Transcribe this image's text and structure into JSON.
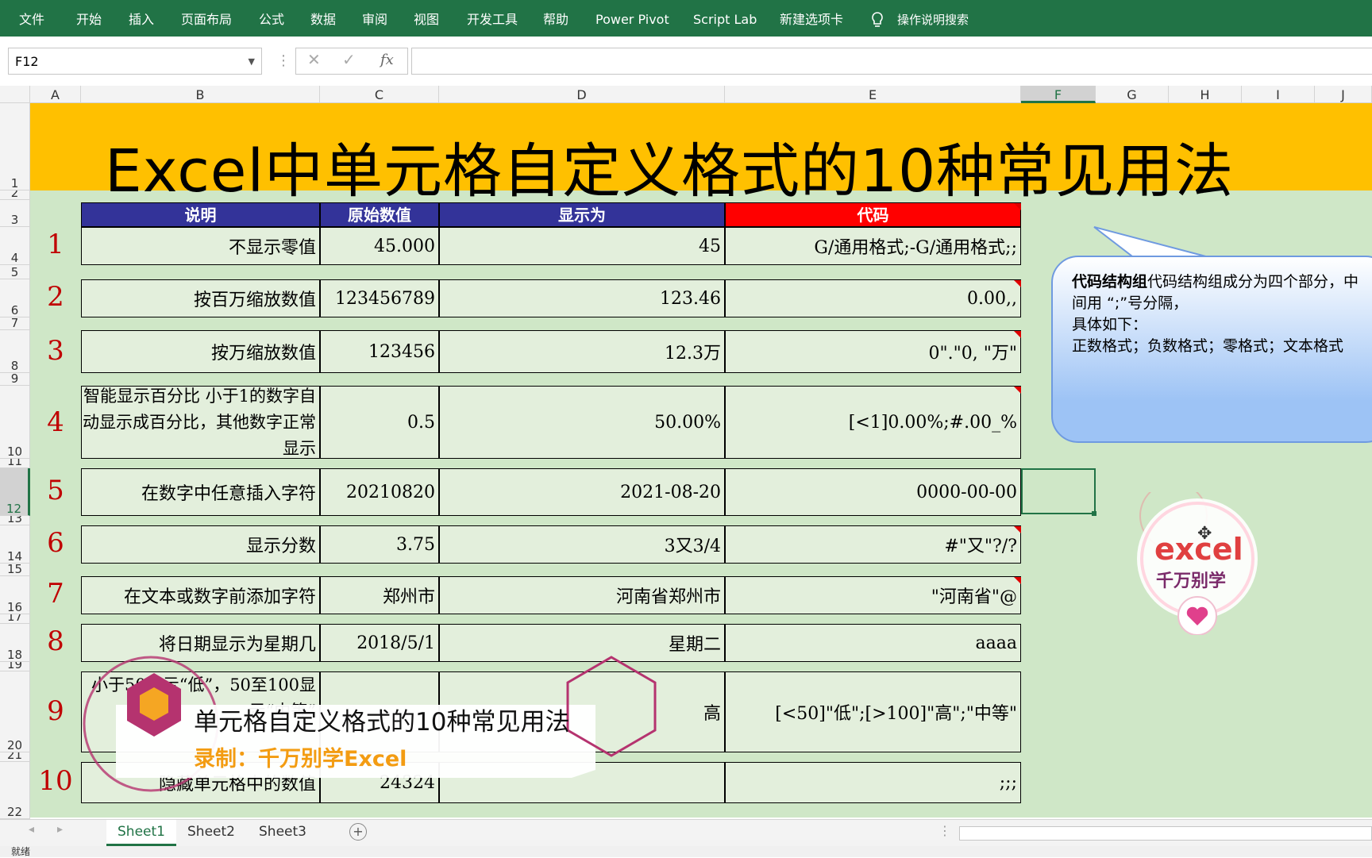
{
  "ribbon": {
    "tabs": [
      "文件",
      "开始",
      "插入",
      "页面布局",
      "公式",
      "数据",
      "审阅",
      "视图",
      "开发工具",
      "帮助",
      "Power Pivot",
      "Script Lab",
      "新建选项卡"
    ],
    "tell_me": "操作说明搜索",
    "color": "#217346"
  },
  "formula_bar": {
    "name_box": "F12",
    "fx": "fx",
    "content": ""
  },
  "columns": [
    "A",
    "B",
    "C",
    "D",
    "E",
    "F",
    "G",
    "H",
    "I",
    "J"
  ],
  "selected_column": "F",
  "rows": [
    "1",
    "2",
    "3",
    "4",
    "5",
    "6",
    "7",
    "8",
    "9",
    "10",
    "11",
    "12",
    "13",
    "14",
    "15",
    "16",
    "17",
    "18",
    "19",
    "20",
    "21",
    "22"
  ],
  "selected_row": "12",
  "title": "Excel中单元格自定义格式的10种常见用法",
  "table": {
    "headers": [
      "说明",
      "原始数值",
      "显示为",
      "代码"
    ],
    "header_color": "#333399",
    "code_header_color": "#ff0000",
    "rows": [
      {
        "n": "1",
        "desc": "不显示零值",
        "raw": "45.000",
        "shown": "45",
        "code": "G/通用格式;-G/通用格式;;"
      },
      {
        "n": "2",
        "desc": "按百万缩放数值",
        "raw": "123456789",
        "shown": "123.46",
        "code": "0.00,,"
      },
      {
        "n": "3",
        "desc": "按万缩放数值",
        "raw": "123456",
        "shown": "12.3万",
        "code": "0\".\"0, \"万\""
      },
      {
        "n": "4",
        "desc": "智能显示百分比 小于1的数字自动显示成百分比，其他数字正常显示",
        "raw": "0.5",
        "shown": "50.00%",
        "code": "[<1]0.00%;#.00_%"
      },
      {
        "n": "5",
        "desc": "在数字中任意插入字符",
        "raw": "20210820",
        "shown": "2021-08-20",
        "code": "0000-00-00"
      },
      {
        "n": "6",
        "desc": "显示分数",
        "raw": "3.75",
        "shown": "3又3/4",
        "code": "#\"又\"?/?"
      },
      {
        "n": "7",
        "desc": "在文本或数字前添加字符",
        "raw": "郑州市",
        "shown": "河南省郑州市",
        "code": "\"河南省\"@"
      },
      {
        "n": "8",
        "desc": "将日期显示为星期几",
        "raw": "2018/5/1",
        "shown": "星期二",
        "code": "aaaa"
      },
      {
        "n": "9",
        "desc": "小于50显示“低”，50至100显示“中等”",
        "raw": "",
        "shown": "高",
        "code": "[<50]\"低\";[>100]\"高\";\"中等\""
      },
      {
        "n": "10",
        "desc": "隐藏单元格中的数值",
        "raw": "24324",
        "shown": "",
        "code": ";;;"
      }
    ]
  },
  "callout": {
    "bold": "代码结构组",
    "line1": "代码结构组成分为四个部分，中",
    "line2": "间用 “;”号分隔，",
    "line3": "具体如下：",
    "line4": "正数格式；负数格式；零格式；文本格式"
  },
  "overlay": {
    "title": "单元格自定义格式的10种常见用法",
    "subtitle": "录制：千万别学Excel",
    "logo_top": "excel",
    "logo_bottom": "千万别学"
  },
  "sheets": [
    "Sheet1",
    "Sheet2",
    "Sheet3"
  ],
  "status_text": "就绪"
}
